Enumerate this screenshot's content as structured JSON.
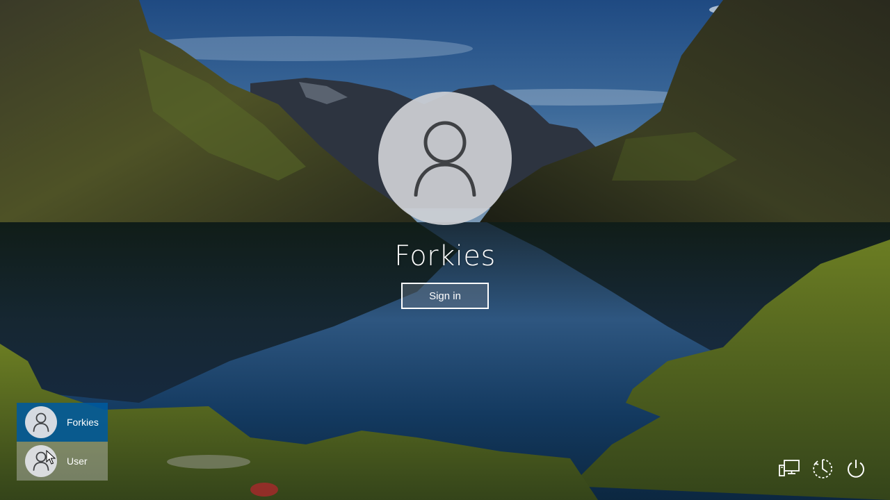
{
  "wallpaper": {
    "description_icon": "mountain-lake-wallpaper"
  },
  "login": {
    "avatar_icon": "user-silhouette-icon",
    "username": "Forkies",
    "signin_label": "Sign in"
  },
  "user_list": [
    {
      "name": "Forkies",
      "selected": true
    },
    {
      "name": "User",
      "selected": false
    }
  ],
  "tray": {
    "network_icon": "network-icon",
    "accessibility_icon": "ease-of-access-icon",
    "power_icon": "power-icon"
  },
  "colors": {
    "selected_user_bg": "#005a9e",
    "text": "#ffffff"
  }
}
